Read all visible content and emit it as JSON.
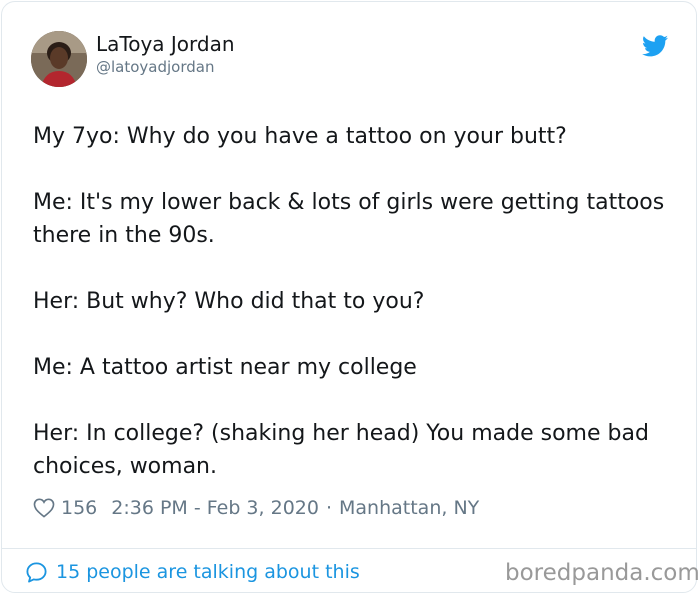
{
  "tweet": {
    "author": {
      "name": "LaToya Jordan",
      "handle": "@latoyadjordan"
    },
    "paragraphs": [
      "My 7yo: Why do you have a tattoo on your butt?",
      "Me: It's my lower back & lots of girls were getting tattoos there in the 90s.",
      "Her: But why? Who did that to you?",
      "Me: A tattoo artist near my college",
      "Her: In college? (shaking her head) You made some bad choices, woman."
    ],
    "likes": "156",
    "timestamp": "2:36 PM - Feb 3, 2020",
    "separator": "·",
    "location": "Manhattan, NY",
    "conversation_link": "15 people are talking about this"
  },
  "watermark": "boredpanda.com",
  "colors": {
    "twitter_blue": "#1b95e0",
    "text": "#14171a",
    "muted": "#657786",
    "border": "#e1e8ed"
  },
  "icons": {
    "brand": "twitter-bird-icon",
    "like": "heart-icon",
    "conversation": "speech-bubble-icon"
  }
}
